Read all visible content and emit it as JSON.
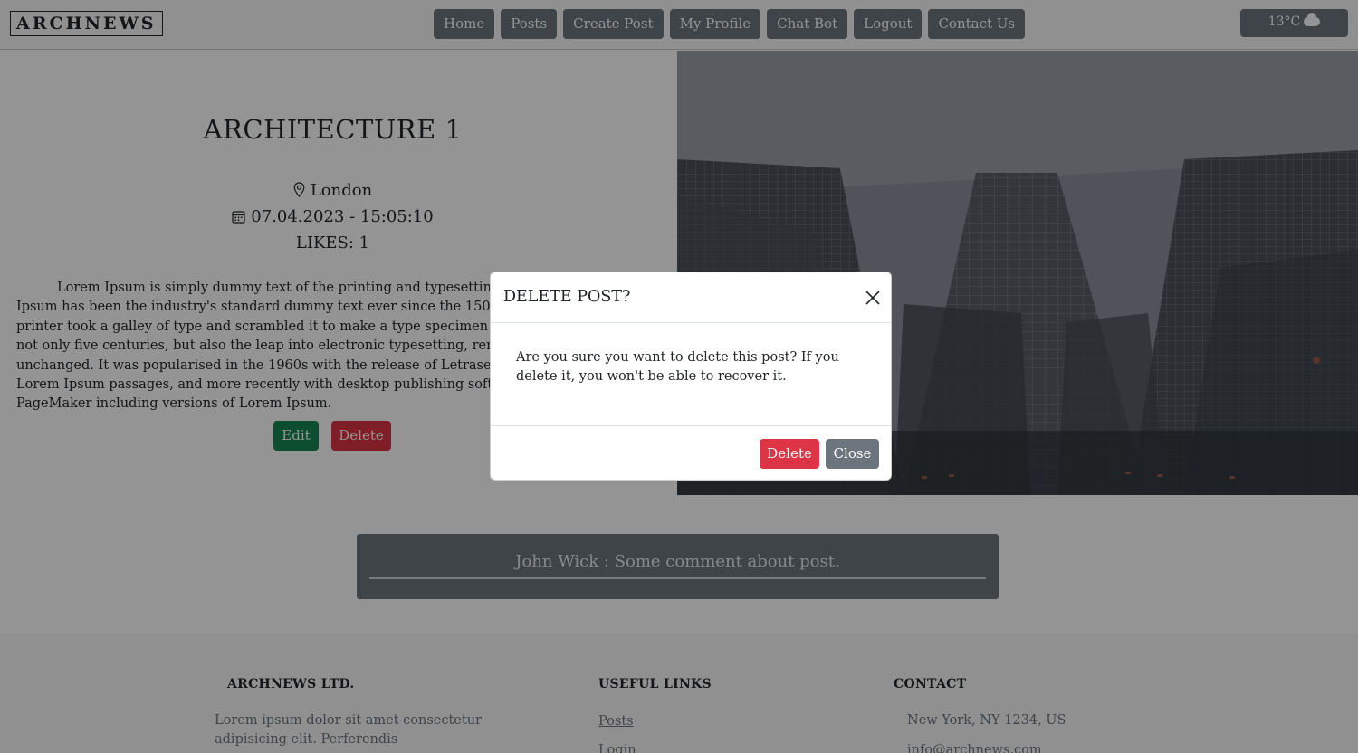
{
  "brand": "ARCHNEWS",
  "nav": [
    "Home",
    "Posts",
    "Create Post",
    "My Profile",
    "Chat Bot",
    "Logout",
    "Contact Us"
  ],
  "weather": {
    "temp": "13°C",
    "icon": "cloud-icon"
  },
  "post": {
    "title": "ARCHITECTURE 1",
    "location": "London",
    "date": "07.04.2023 - 15:05:10",
    "likes": "LIKES: 1",
    "body": "Lorem Ipsum is simply dummy text of the printing and typesetting industry. Lorem Ipsum has been the industry's standard dummy text ever since the 1500s, when an unknown printer took a galley of type and scrambled it to make a type specimen book. It has survived not only five centuries, but also the leap into electronic typesetting, remaining essentially unchanged. It was popularised in the 1960s with the release of Letraset sheets containing Lorem Ipsum passages, and more recently with desktop publishing software like Aldus PageMaker including versions of Lorem Ipsum.",
    "edit_label": "Edit",
    "delete_label": "Delete"
  },
  "comment": "John Wick : Some comment about post.",
  "footer": {
    "company_heading": "ARCHNEWS LTD.",
    "company_text": "Lorem ipsum dolor sit amet consectetur adipisicing elit. Perferendis",
    "links_heading": "USEFUL LINKS",
    "links": [
      "Posts",
      "Login"
    ],
    "contact_heading": "CONTACT",
    "contact": [
      "New York, NY 1234, US",
      "info@archnews.com"
    ]
  },
  "modal": {
    "title": "DELETE POST?",
    "body": "Are you sure you want to delete this post? If you delete it, you won't be able to recover it.",
    "delete_label": "Delete",
    "close_label": "Close"
  },
  "colors": {
    "danger": "#dc3545",
    "success": "#198754",
    "secondary": "#6c757d"
  }
}
